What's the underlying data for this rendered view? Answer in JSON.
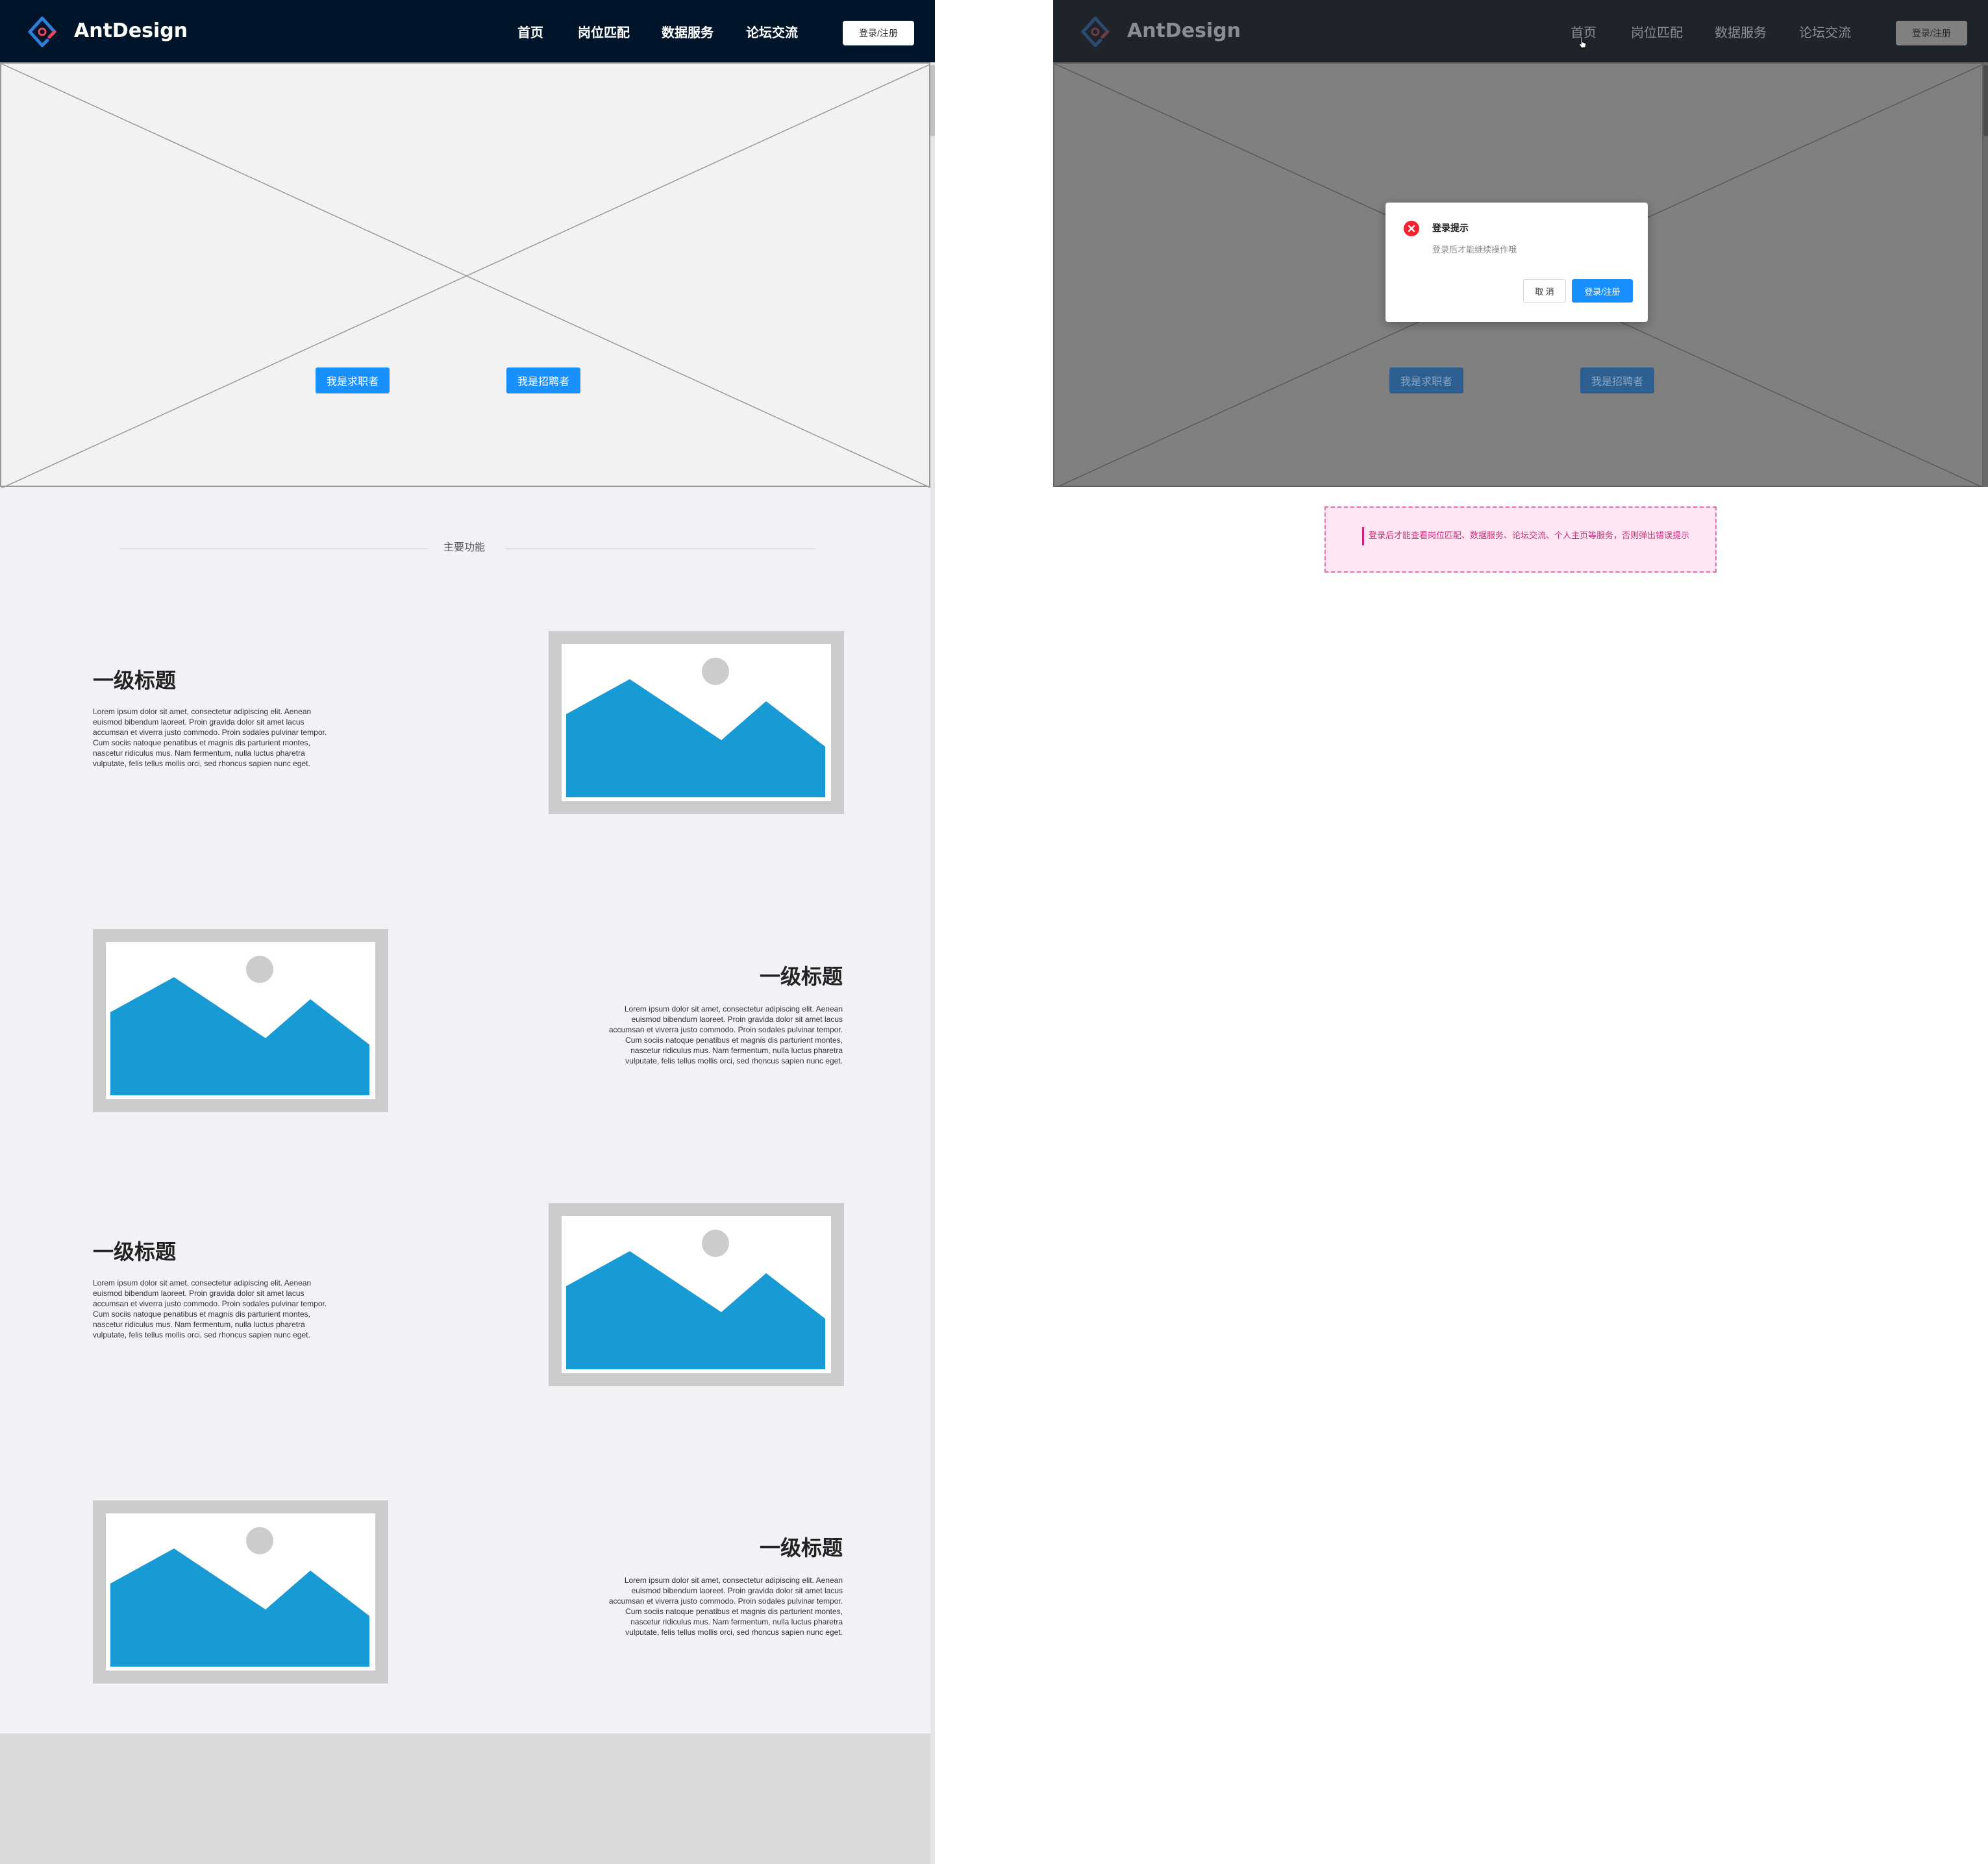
{
  "left_screen": {
    "header": {
      "logo_text": "AntDesign",
      "nav_items": [
        {
          "label": "首页"
        },
        {
          "label": "岗位匹配"
        },
        {
          "label": "数据服务"
        },
        {
          "label": "论坛交流"
        }
      ],
      "login_button": "登录/注册"
    },
    "hero": {
      "job_seeker_button": "我是求职者",
      "recruiter_button": "我是招聘者"
    },
    "section_divider": "主要功能",
    "features": [
      {
        "title": "一级标题",
        "text": "Lorem ipsum dolor sit amet, consectetur adipiscing elit. Aenean euismod bibendum laoreet. Proin gravida dolor sit amet lacus accumsan et viverra justo commodo. Proin sodales pulvinar tempor. Cum sociis natoque penatibus et magnis dis parturient montes, nascetur ridiculus mus. Nam fermentum, nulla luctus pharetra vulputate, felis tellus mollis orci, sed rhoncus sapien nunc eget."
      },
      {
        "title": "一级标题",
        "text": "Lorem ipsum dolor sit amet, consectetur adipiscing elit. Aenean euismod bibendum laoreet. Proin gravida dolor sit amet lacus accumsan et viverra justo commodo. Proin sodales pulvinar tempor. Cum sociis natoque penatibus et magnis dis parturient montes, nascetur ridiculus mus. Nam fermentum, nulla luctus pharetra vulputate, felis tellus mollis orci, sed rhoncus sapien nunc eget."
      },
      {
        "title": "一级标题",
        "text": "Lorem ipsum dolor sit amet, consectetur adipiscing elit. Aenean euismod bibendum laoreet. Proin gravida dolor sit amet lacus accumsan et viverra justo commodo. Proin sodales pulvinar tempor. Cum sociis natoque penatibus et magnis dis parturient montes, nascetur ridiculus mus. Nam fermentum, nulla luctus pharetra vulputate, felis tellus mollis orci, sed rhoncus sapien nunc eget."
      },
      {
        "title": "一级标题",
        "text": "Lorem ipsum dolor sit amet, consectetur adipiscing elit. Aenean euismod bibendum laoreet. Proin gravida dolor sit amet lacus accumsan et viverra justo commodo. Proin sodales pulvinar tempor. Cum sociis natoque penatibus et magnis dis parturient montes, nascetur ridiculus mus. Nam fermentum, nulla luctus pharetra vulputate, felis tellus mollis orci, sed rhoncus sapien nunc eget."
      }
    ]
  },
  "right_screen": {
    "header": {
      "logo_text": "AntDesign",
      "nav_items": [
        {
          "label": "首页"
        },
        {
          "label": "岗位匹配"
        },
        {
          "label": "数据服务"
        },
        {
          "label": "论坛交流"
        }
      ],
      "login_button": "登录/注册"
    },
    "hero": {
      "job_seeker_button": "我是求职者",
      "recruiter_button": "我是招聘者"
    },
    "modal": {
      "icon": "error-circle-icon",
      "title": "登录提示",
      "content": "登录后才能继续操作哦",
      "cancel_button": "取 消",
      "ok_button": "登录/注册"
    }
  },
  "annotation": {
    "text": "登录后才能查看岗位匹配、数据服务、论坛交流、个人主页等服务，否则弹出错误提示"
  },
  "colors": {
    "nav_bg": "#001529",
    "primary": "#1890ff",
    "page_bg": "#f0f2f5",
    "image_fill": "#189bd4",
    "error": "#f5222d",
    "annotation_border": "#e46fae"
  }
}
